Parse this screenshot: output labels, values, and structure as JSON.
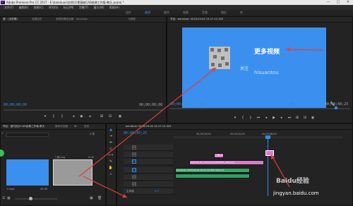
{
  "titlebar": {
    "title": "Adobe Premiere Pro CC 2017 - E:\\baniduan\\实例\\2\\零基础CAD经典工作版-教头.prproj *",
    "minimize": "—",
    "maximize": "□",
    "close": "✕"
  },
  "menu": [
    "文件(F)",
    "编辑(E)",
    "剪辑(C)",
    "序列(S)",
    "标记(M)",
    "字幕(T)",
    "窗口(W)",
    "帮助(H)"
  ],
  "workspaces": [
    "组件",
    "编辑",
    "颜色",
    "效果",
    "音频",
    "图形",
    "库"
  ],
  "source_panel": {
    "tabs": [
      "源：(无剪辑)",
      "效果控件",
      "音频剪辑混合器：baniduan",
      "元数据"
    ],
    "timecode_left": "00;00;00;00",
    "timecode_right": "00;00;00;00"
  },
  "program_panel": {
    "tab": "节目：baniduan 2018-03-04 19-27-12-325",
    "timecode": "00;00;45;25",
    "fit": "适合",
    "ratio": "完整",
    "duration": "00;00;48;23",
    "overlay": {
      "title": "更多视频",
      "follow": "关注",
      "handle": "hisuantou"
    }
  },
  "project_panel": {
    "tabs": [
      "项目：室内设计CAD经典工作版-教头",
      "媒体浏览器",
      "库",
      "信息"
    ],
    "search_placeholder": "",
    "count": "4 项",
    "items": [
      {
        "name": "1.mp4",
        "duration": "44:00",
        "color": "#3b8fee"
      },
      {
        "name": "二维.png",
        "duration": "5;00",
        "color": "#9a9a9a"
      }
    ]
  },
  "timeline": {
    "tab": "baniduan 2018-03-04 19-27-12-325",
    "timecode": "00;00;45;25",
    "ruler": [
      "00;00;16;00",
      "00;00;32;00",
      "00;00;48;00"
    ],
    "tracks_video": [
      "V3",
      "V2",
      "V1"
    ],
    "tracks_audio": [
      "A1",
      "A2",
      "A3"
    ],
    "master": "主声道",
    "master_value": "0.0",
    "clips": [
      {
        "label": "二维.png",
        "track": "V2",
        "color": "#e07ad6"
      },
      {
        "label": "episode_fin_cad_baniduan0505_dsss.png",
        "track": "V1",
        "color": "#d77cc9"
      },
      {
        "label": "baniduan 2018-03-04 19-27-12-325.mp4 [V]",
        "track": "V1",
        "color": "#3aa267"
      },
      {
        "label": "audio",
        "track": "A1",
        "color": "#2e9f66"
      }
    ]
  },
  "watermark": {
    "brand": "Baidu经验",
    "url": "jingyan.baidu.com"
  },
  "colors": {
    "accent": "#2f8be6",
    "frame": "#3b8fee",
    "arrow": "#e53b3b",
    "clip_pink": "#d77cc9",
    "clip_green": "#2e9f66"
  }
}
